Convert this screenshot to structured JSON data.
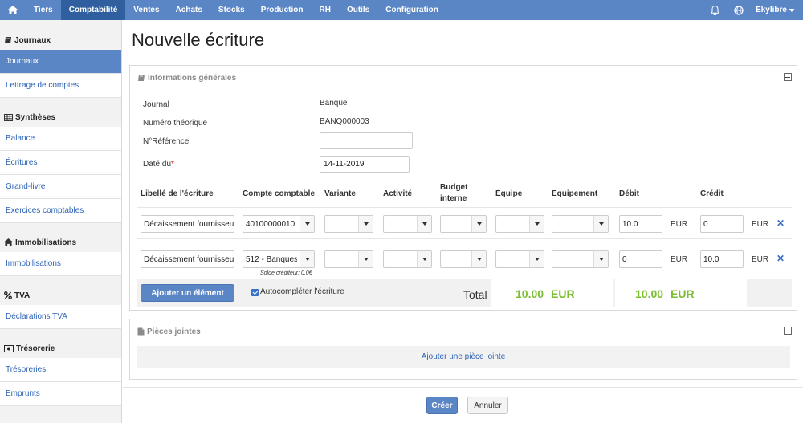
{
  "nav": {
    "items": [
      "Tiers",
      "Comptabilité",
      "Ventes",
      "Achats",
      "Stocks",
      "Production",
      "RH",
      "Outils",
      "Configuration"
    ],
    "active": "Comptabilité",
    "user": "Ekylibre"
  },
  "sidebar": {
    "sections": [
      {
        "title": "Journaux",
        "icon": "book-icon",
        "items": [
          "Journaux",
          "Lettrage de comptes"
        ]
      },
      {
        "title": "Synthèses",
        "icon": "table-icon",
        "items": [
          "Balance",
          "Écritures",
          "Grand-livre",
          "Exercices comptables"
        ]
      },
      {
        "title": "Immobilisations",
        "icon": "home-icon",
        "items": [
          "Immobilisations"
        ]
      },
      {
        "title": "TVA",
        "icon": "percent-icon",
        "items": [
          "Déclarations TVA"
        ]
      },
      {
        "title": "Trésorerie",
        "icon": "money-icon",
        "items": [
          "Trésoreries",
          "Emprunts"
        ]
      }
    ],
    "active_item": "Journaux"
  },
  "page": {
    "title": "Nouvelle écriture"
  },
  "general": {
    "title": "Informations générales",
    "journal_label": "Journal",
    "journal_value": "Banque",
    "numero_label": "Numéro théorique",
    "numero_value": "BANQ000003",
    "reference_label": "N°Référence",
    "reference_value": "",
    "date_label": "Daté du",
    "date_required": "*",
    "date_value": "14-11-2019"
  },
  "table": {
    "headers": {
      "libelle": "Libellé de l'écriture",
      "compte": "Compte comptable",
      "variante": "Variante",
      "activite": "Activité",
      "budget": "Budget interne",
      "equipe": "Équipe",
      "equipement": "Equipement",
      "debit": "Débit",
      "credit": "Crédit"
    },
    "rows": [
      {
        "libelle": "Décaissement fournisseur",
        "compte": "40100000010.",
        "debit": "10.0",
        "debit_currency": "EUR",
        "credit": "0",
        "credit_currency": "EUR",
        "note": ""
      },
      {
        "libelle": "Décaissement fournisseur",
        "compte": "512 - Banques",
        "debit": "0",
        "debit_currency": "EUR",
        "credit": "10.0",
        "credit_currency": "EUR",
        "note": "Solde créditeur: 0.0€"
      }
    ],
    "add_button": "Ajouter un élément",
    "autocomplete_label": "Autocompléter l'écriture",
    "total_label": "Total",
    "total_debit": "10.00",
    "total_debit_currency": "EUR",
    "total_credit": "10.00",
    "total_credit_currency": "EUR"
  },
  "attachments": {
    "title": "Pièces jointes",
    "add_link": "Ajouter une pièce jointe"
  },
  "actions": {
    "create": "Créer",
    "cancel": "Annuler"
  },
  "colors": {
    "nav": "#5b86c6",
    "nav_active": "#2f5f9f",
    "link": "#2a62b5",
    "total_green": "#7cbe31"
  }
}
